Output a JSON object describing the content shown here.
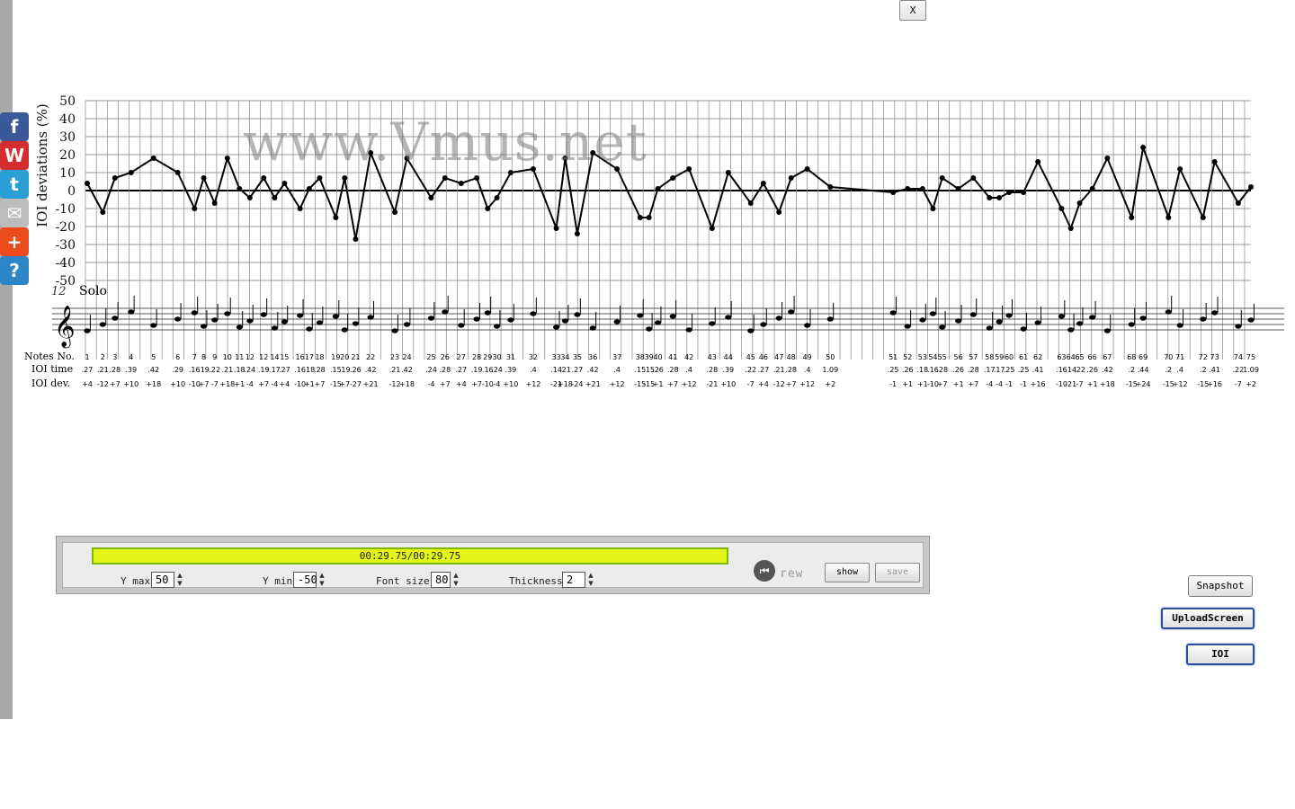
{
  "close_label": "X",
  "share": [
    {
      "name": "facebook",
      "glyph": "f",
      "color": "#3b5998"
    },
    {
      "name": "weibo",
      "glyph": "W",
      "color": "#d42d2f"
    },
    {
      "name": "twitter",
      "glyph": "t",
      "color": "#2a9fd6"
    },
    {
      "name": "email",
      "glyph": "✉",
      "color": "#bdbdbd"
    },
    {
      "name": "more",
      "glyph": "+",
      "color": "#ec4b1b"
    },
    {
      "name": "help",
      "glyph": "?",
      "color": "#2e86c9"
    }
  ],
  "chart": {
    "watermark": "www.Vmus.net",
    "ylabel": "IOI deviations (%)",
    "y_ticks": [
      50,
      40,
      30,
      20,
      10,
      0,
      -10,
      -20,
      -30,
      -40,
      -50
    ],
    "ylim": [
      -50,
      50
    ],
    "measure_number": "12",
    "part_label": "Solo",
    "row_labels": {
      "notes": "Notes No.",
      "time": "IOI time",
      "dev": "IOI dev."
    },
    "points": [
      {
        "no": "1",
        "time": ".27",
        "dev": "+4"
      },
      {
        "no": "2",
        "time": ".21",
        "dev": "-12"
      },
      {
        "no": "3",
        "time": ".28",
        "dev": "+7"
      },
      {
        "no": "4",
        "time": ".39",
        "dev": "+10"
      },
      {
        "no": "5",
        "time": ".42",
        "dev": "+18"
      },
      {
        "no": "6",
        "time": ".29",
        "dev": "+10"
      },
      {
        "no": "7",
        "time": ".16",
        "dev": "-10"
      },
      {
        "no": "8",
        "time": ".19",
        "dev": "+7"
      },
      {
        "no": "9",
        "time": ".22",
        "dev": "-7"
      },
      {
        "no": "10",
        "time": ".21",
        "dev": "+18"
      },
      {
        "no": "11",
        "time": ".18",
        "dev": "+1"
      },
      {
        "no": "12",
        "time": ".24",
        "dev": "-4"
      },
      {
        "no": "12",
        "time": ".19",
        "dev": "+7"
      },
      {
        "no": "14",
        "time": ".17",
        "dev": "-4"
      },
      {
        "no": "15",
        "time": ".27",
        "dev": "+4"
      },
      {
        "no": "16",
        "time": ".16",
        "dev": "-10"
      },
      {
        "no": "17",
        "time": ".18",
        "dev": "+1"
      },
      {
        "no": "18",
        "time": ".28",
        "dev": "+7"
      },
      {
        "no": "19",
        "time": ".15",
        "dev": "-15"
      },
      {
        "no": "20",
        "time": ".19",
        "dev": "+7"
      },
      {
        "no": "21",
        "time": ".26",
        "dev": "-27"
      },
      {
        "no": "22",
        "time": ".42",
        "dev": "+21"
      },
      {
        "no": "23",
        "time": ".21",
        "dev": "-12"
      },
      {
        "no": "24",
        "time": ".42",
        "dev": "+18"
      },
      {
        "no": "25",
        "time": ".24",
        "dev": "-4"
      },
      {
        "no": "26",
        "time": ".28",
        "dev": "+7"
      },
      {
        "no": "27",
        "time": ".27",
        "dev": "+4"
      },
      {
        "no": "28",
        "time": ".19",
        "dev": "+7"
      },
      {
        "no": "29",
        "time": ".16",
        "dev": "-10"
      },
      {
        "no": "30",
        "time": ".24",
        "dev": "-4"
      },
      {
        "no": "31",
        "time": ".39",
        "dev": "+10"
      },
      {
        "no": "32",
        "time": ".4",
        "dev": "+12"
      },
      {
        "no": "33",
        "time": ".14",
        "dev": "-21"
      },
      {
        "no": "34",
        "time": ".21",
        "dev": "+18"
      },
      {
        "no": "35",
        "time": ".27",
        "dev": "-24"
      },
      {
        "no": "36",
        "time": ".42",
        "dev": "+21"
      },
      {
        "no": "37",
        "time": ".4",
        "dev": "+12"
      },
      {
        "no": "38",
        "time": ".15",
        "dev": "-15"
      },
      {
        "no": "39",
        "time": ".15",
        "dev": "-15"
      },
      {
        "no": "40",
        "time": ".26",
        "dev": "+1"
      },
      {
        "no": "41",
        "time": ".28",
        "dev": "+7"
      },
      {
        "no": "42",
        "time": ".4",
        "dev": "+12"
      },
      {
        "no": "43",
        "time": ".28",
        "dev": "-21"
      },
      {
        "no": "44",
        "time": ".39",
        "dev": "+10"
      },
      {
        "no": "45",
        "time": ".22",
        "dev": "-7"
      },
      {
        "no": "46",
        "time": ".27",
        "dev": "+4"
      },
      {
        "no": "47",
        "time": ".21",
        "dev": "-12"
      },
      {
        "no": "48",
        "time": ".28",
        "dev": "+7"
      },
      {
        "no": "49",
        "time": ".4",
        "dev": "+12"
      },
      {
        "no": "50",
        "time": "1.09",
        "dev": "+2"
      },
      {
        "no": "51",
        "time": ".25",
        "dev": "-1"
      },
      {
        "no": "52",
        "time": ".26",
        "dev": "+1"
      },
      {
        "no": "53",
        "time": ".18",
        "dev": "+1"
      },
      {
        "no": "54",
        "time": ".16",
        "dev": "-10"
      },
      {
        "no": "55",
        "time": ".28",
        "dev": "+7"
      },
      {
        "no": "56",
        "time": ".26",
        "dev": "+1"
      },
      {
        "no": "57",
        "time": ".28",
        "dev": "+7"
      },
      {
        "no": "58",
        "time": ".17",
        "dev": "-4"
      },
      {
        "no": "59",
        "time": ".17",
        "dev": "-4"
      },
      {
        "no": "60",
        "time": ".25",
        "dev": "-1"
      },
      {
        "no": "61",
        "time": ".25",
        "dev": "-1"
      },
      {
        "no": "62",
        "time": ".41",
        "dev": "+16"
      },
      {
        "no": "63",
        "time": ".16",
        "dev": "-10"
      },
      {
        "no": "64",
        "time": ".14",
        "dev": "-21"
      },
      {
        "no": "65",
        "time": ".22",
        "dev": "-7"
      },
      {
        "no": "66",
        "time": ".26",
        "dev": "+1"
      },
      {
        "no": "67",
        "time": ".42",
        "dev": "+18"
      },
      {
        "no": "68",
        "time": ".2",
        "dev": "-15"
      },
      {
        "no": "69",
        "time": ".44",
        "dev": "+24"
      },
      {
        "no": "70",
        "time": ".2",
        "dev": "-15"
      },
      {
        "no": "71",
        "time": ".4",
        "dev": "+12"
      },
      {
        "no": "72",
        "time": ".2",
        "dev": "-15"
      },
      {
        "no": "73",
        "time": ".41",
        "dev": "+16"
      },
      {
        "no": "74",
        "time": ".22",
        "dev": "-7"
      },
      {
        "no": "75",
        "time": "1.09",
        "dev": "+2"
      }
    ]
  },
  "chart_data": {
    "type": "line",
    "ylabel": "IOI deviations (%)",
    "ylim": [
      -50,
      50
    ],
    "grid": true,
    "x": [
      1,
      2,
      3,
      4,
      5,
      6,
      7,
      8,
      9,
      10,
      11,
      12,
      13,
      14,
      15,
      16,
      17,
      18,
      19,
      20,
      21,
      22,
      23,
      24,
      25,
      26,
      27,
      28,
      29,
      30,
      31,
      32,
      33,
      34,
      35,
      36,
      37,
      38,
      39,
      40,
      41,
      42,
      43,
      44,
      45,
      46,
      47,
      48,
      49,
      50,
      51,
      52,
      53,
      54,
      55,
      56,
      57,
      58,
      59,
      60,
      61,
      62,
      63,
      64,
      65,
      66,
      67,
      68,
      69,
      70,
      71,
      72,
      73,
      74,
      75
    ],
    "series": [
      {
        "values": [
          4,
          -12,
          7,
          10,
          18,
          10,
          -10,
          7,
          -7,
          18,
          1,
          -4,
          7,
          -4,
          4,
          -10,
          1,
          7,
          -15,
          7,
          -27,
          21,
          -12,
          18,
          -4,
          7,
          4,
          7,
          -10,
          -4,
          10,
          12,
          -21,
          18,
          -24,
          21,
          12,
          -15,
          -15,
          1,
          7,
          12,
          -21,
          10,
          -7,
          4,
          -12,
          7,
          12,
          2,
          -1,
          1,
          1,
          -10,
          7,
          1,
          7,
          -4,
          -4,
          -1,
          -1,
          16,
          -10,
          -21,
          -7,
          1,
          18,
          -15,
          24,
          -15,
          12,
          -15,
          16,
          -7,
          2
        ]
      }
    ]
  },
  "controls": {
    "progress_text": "00:29.75/00:29.75",
    "progress_fraction": 1.0,
    "ymax_label": "Y max",
    "ymax_value": "50",
    "ymin_label": "Y min",
    "ymin_value": "-50",
    "fontsize_label": "Font size",
    "fontsize_value": "80",
    "thickness_label": "Thickness",
    "thickness_value": "2",
    "rew_label": "rew",
    "show_label": "show",
    "save_label": "save"
  },
  "side_buttons": {
    "snapshot": "Snapshot",
    "upload": "UploadScreen",
    "ioi": "IOI"
  }
}
